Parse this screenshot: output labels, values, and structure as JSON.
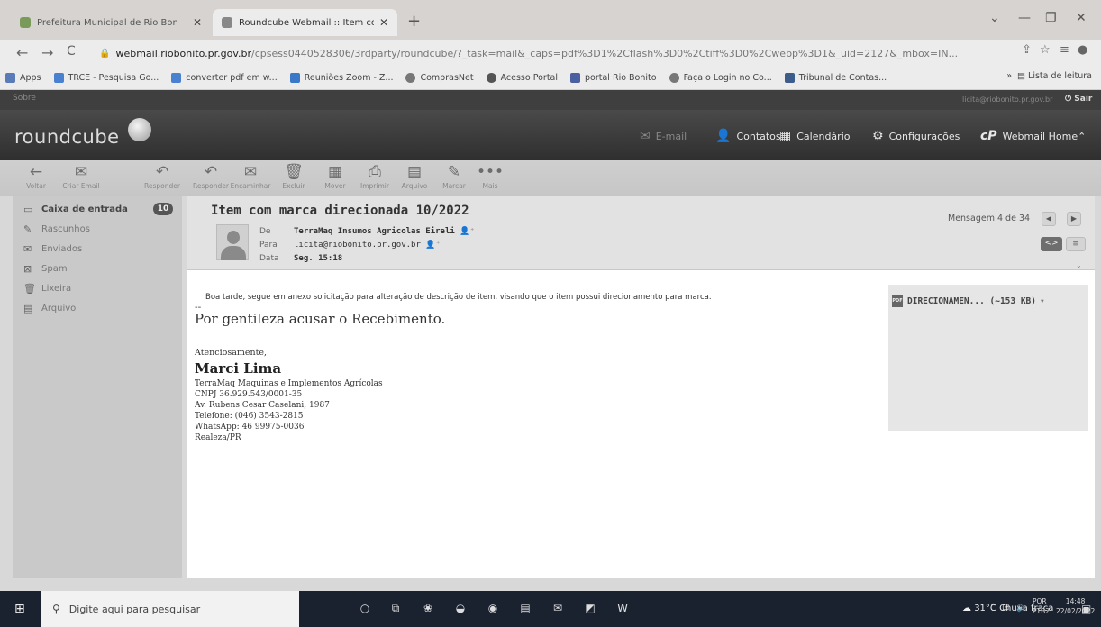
{
  "browser": {
    "tabs": [
      {
        "title": "Prefeitura Municipal de Rio Bon",
        "active": false
      },
      {
        "title": "Roundcube Webmail :: Item com",
        "active": true
      }
    ],
    "new_tab": "+",
    "window_controls": [
      "⌄",
      "—",
      "❐",
      "✕"
    ],
    "nav": {
      "back": "←",
      "forward": "→",
      "reload": "C"
    },
    "url_host": "webmail.riobonito.pr.gov.br",
    "url_path": "/cpsess0440528306/3rdparty/roundcube/?_task=mail&_caps=pdf%3D1%2Cflash%3D0%2Ctiff%3D0%2Cwebp%3D1&_uid=2127&_mbox=IN...",
    "bookmarks": [
      {
        "label": "Apps",
        "icon": "apps-grid-icon",
        "color": "#5a7ab8"
      },
      {
        "label": "TRCE - Pesquisa Go...",
        "icon": "google-icon",
        "color": "#4a80d0"
      },
      {
        "label": "converter pdf em w...",
        "icon": "google-icon",
        "color": "#4a80d0"
      },
      {
        "label": "Reuniões Zoom - Z...",
        "icon": "zoom-icon",
        "color": "#3a78c8"
      },
      {
        "label": "ComprasNet",
        "icon": "globe-icon",
        "color": "#777777"
      },
      {
        "label": "Acesso Portal",
        "icon": "globe-icon",
        "color": "#555555"
      },
      {
        "label": "portal Rio Bonito",
        "icon": "portal-icon",
        "color": "#4a60a0"
      },
      {
        "label": "Faça o Login no Co...",
        "icon": "globe-icon",
        "color": "#777777"
      },
      {
        "label": "Tribunal de Contas...",
        "icon": "tribunal-icon",
        "color": "#3c5c8c"
      }
    ],
    "reading_list": "Lista de leitura"
  },
  "roundcube": {
    "top_left": "Sobre",
    "user": "licita@riobonito.pr.gov.br",
    "logout": "Sair",
    "logo": "roundcube",
    "nav": {
      "email": "E-mail",
      "contacts": "Contatos",
      "calendar": "Calendário",
      "settings": "Configurações",
      "home": "Webmail Home"
    },
    "toolbar": [
      {
        "label": "Voltar",
        "icon": "←",
        "name": "back"
      },
      {
        "label": "Criar Email",
        "icon": "✉",
        "name": "compose"
      },
      {
        "label": "Responder",
        "icon": "↶",
        "name": "reply"
      },
      {
        "label": "Responder",
        "icon": "↶",
        "name": "reply-all"
      },
      {
        "label": "Encaminhar",
        "icon": "✉",
        "name": "forward"
      },
      {
        "label": "Excluir",
        "icon": "🗑",
        "name": "delete"
      },
      {
        "label": "Mover",
        "icon": "▦",
        "name": "move"
      },
      {
        "label": "Imprimir",
        "icon": "⎙",
        "name": "print"
      },
      {
        "label": "Arquivo",
        "icon": "▤",
        "name": "archive"
      },
      {
        "label": "Marcar",
        "icon": "✎",
        "name": "mark"
      },
      {
        "label": "Mais",
        "icon": "•••",
        "name": "more"
      }
    ],
    "folders": [
      {
        "label": "Caixa de entrada",
        "icon": "▭",
        "active": true
      },
      {
        "label": "Rascunhos",
        "icon": "✎",
        "active": false
      },
      {
        "label": "Enviados",
        "icon": "✉",
        "active": false
      },
      {
        "label": "Spam",
        "icon": "⊠",
        "active": false
      },
      {
        "label": "Lixeira",
        "icon": "🗑",
        "active": false
      },
      {
        "label": "Arquivo",
        "icon": "▤",
        "active": false
      }
    ],
    "unread_count": "10"
  },
  "message": {
    "subject": "Item com marca direcionada 10/2022",
    "from_label": "De",
    "from": "TerraMaq Insumos Agricolas Eireli",
    "to_label": "Para",
    "to": "licita@riobonito.pr.gov.br",
    "date_label": "Data",
    "date": "Seg. 15:18",
    "count": "Mensagem 4 de 34",
    "body_line1": "Boa tarde, segue em anexo solicitação para alteração de descrição de item, visando que o item possui direcionamento para marca.",
    "separator": "--",
    "body_line2": "Por gentileza acusar o Recebimento.",
    "closing": "Atenciosamente,",
    "signature_name": "Marci Lima",
    "signature_lines": [
      "TerraMaq Maquinas e Implementos Agrícolas",
      "CNPJ 36.929.543/0001-35",
      "Av. Rubens Cesar Caselani, 1987",
      "Telefone: (046) 3543-2815",
      "WhatsApp: 46 99975-0036",
      "Realeza/PR"
    ],
    "attachment": "DIRECIONAMEN... (~153 KB)",
    "attachment_type": "PDF"
  },
  "taskbar": {
    "search_placeholder": "Digite aqui para pesquisar",
    "weather": "31°C Chuva fraca",
    "lang_top": "POR",
    "lang_bottom": "PTB2",
    "time": "14:48",
    "date": "22/02/2022"
  }
}
